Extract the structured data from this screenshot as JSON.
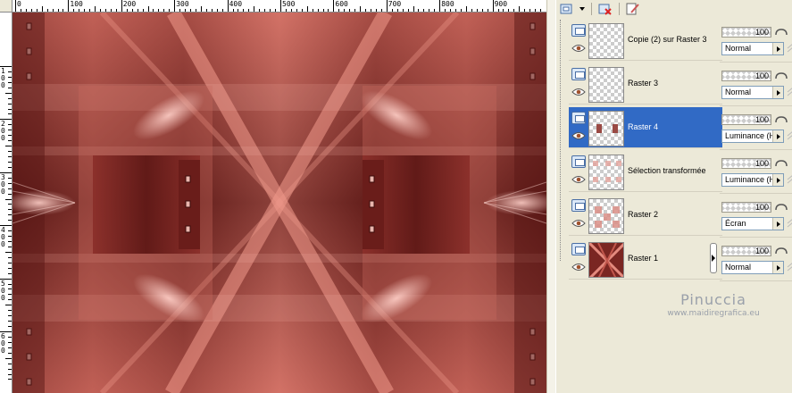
{
  "rulers": {
    "top_labels": [
      "0",
      "100",
      "200",
      "300",
      "400",
      "500",
      "600",
      "700",
      "800",
      "900"
    ],
    "left_labels": [
      "1\n0\n0",
      "2\n0\n0",
      "3\n0\n0",
      "4\n0\n0",
      "5\n0\n0",
      "6\n0\n0"
    ]
  },
  "palette": {
    "toolbar_icons": [
      "new-layer-icon",
      "delete-layer-icon",
      "edit-icon"
    ],
    "layers": [
      {
        "name": "Copie (2) sur Raster 3",
        "opacity": "100",
        "blend": "Normal",
        "selected": false,
        "thumb": "empty"
      },
      {
        "name": "Raster 3",
        "opacity": "100",
        "blend": "Normal",
        "selected": false,
        "thumb": "empty"
      },
      {
        "name": "Raster 4",
        "opacity": "100",
        "blend": "Luminance (H)",
        "selected": true,
        "thumb": "dots"
      },
      {
        "name": "Sélection transformée",
        "opacity": "100",
        "blend": "Luminance (H)",
        "selected": false,
        "thumb": "pattern"
      },
      {
        "name": "Raster 2",
        "opacity": "100",
        "blend": "Écran",
        "selected": false,
        "thumb": "pattern2"
      },
      {
        "name": "Raster 1",
        "opacity": "100",
        "blend": "Normal",
        "selected": false,
        "thumb": "red"
      }
    ]
  },
  "watermark": {
    "name": "Pinuccia",
    "url": "www.maidiregrafica.eu"
  },
  "colors": {
    "selection": "#316ac5",
    "canvas_base": "#a8403a",
    "canvas_light": "#e8857a"
  }
}
